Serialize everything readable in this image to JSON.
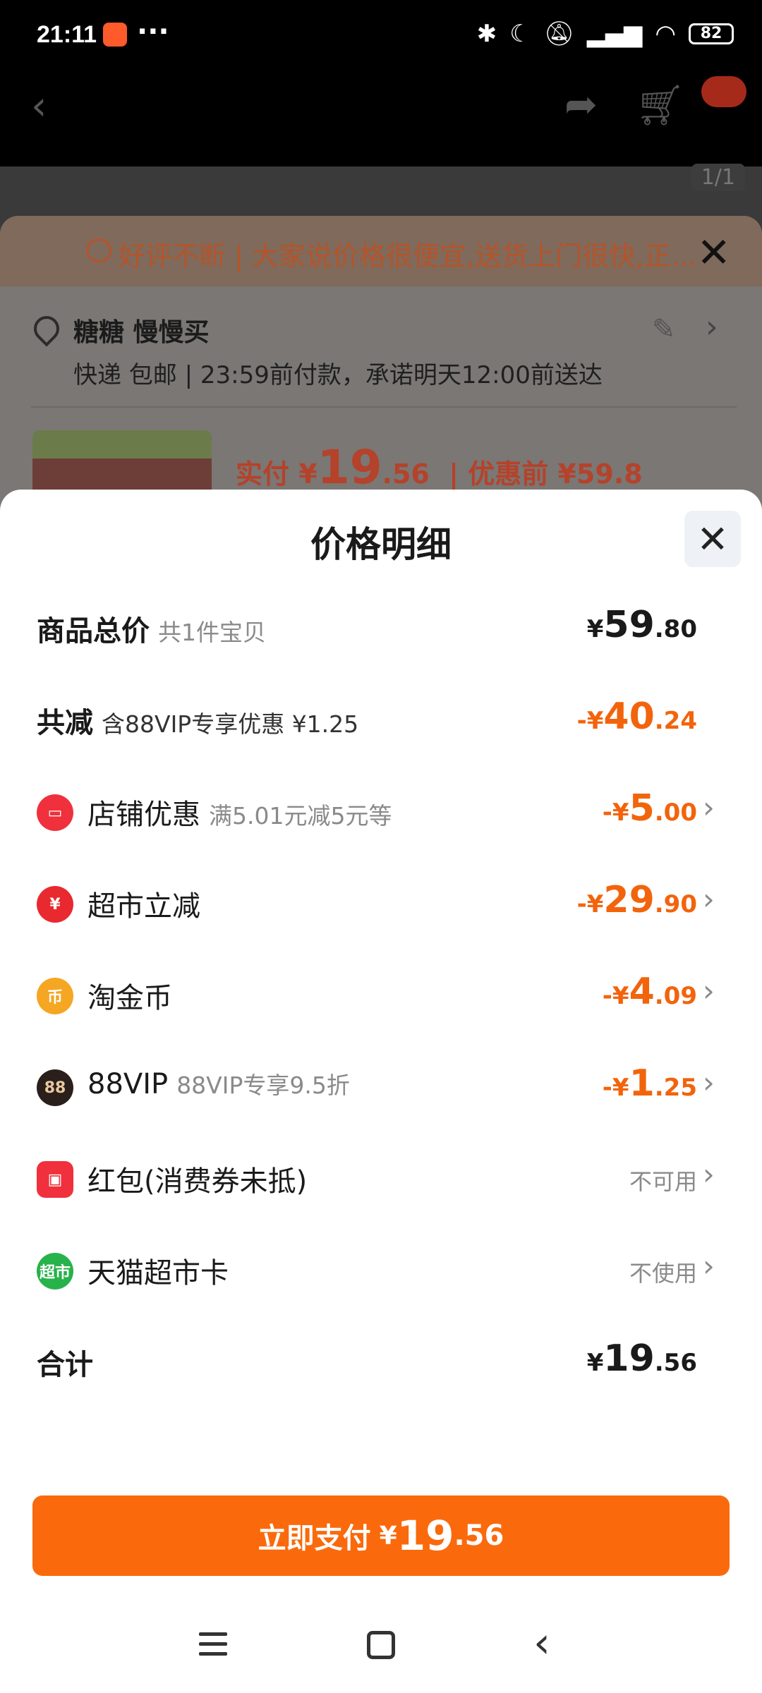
{
  "status_bar": {
    "time": "21:11",
    "dots": "···",
    "battery": "82",
    "icons": [
      "bluetooth-icon",
      "moon-icon",
      "mute-icon",
      "signal-icon",
      "wifi-icon"
    ]
  },
  "background": {
    "pager": "1/1",
    "banner_text": "好评不断 | 大家说价格很便宜,送货上门很快,正...",
    "address_name": "糖糖 慢慢买",
    "address_sub": "快递 包邮 | 23:59前付款，承诺明天12:00前送达",
    "price_prefix": "实付 ¥",
    "price_int": "19",
    "price_dec": ".56",
    "price_before": "| 优惠前 ¥59.8"
  },
  "sheet": {
    "title": "价格明细",
    "rows": [
      {
        "label": "商品总价",
        "sub": "共1件宝贝",
        "cur": "¥",
        "int": "59",
        "dec": ".80"
      },
      {
        "label": "共减",
        "sub": "含88VIP专享优惠 ¥1.25",
        "cur": "-¥",
        "int": "40",
        "dec": ".24"
      },
      {
        "label": "店铺优惠",
        "sub": "满5.01元减5元等",
        "cur": "-¥",
        "int": "5",
        "dec": ".00"
      },
      {
        "label": "超市立减",
        "sub": "",
        "cur": "-¥",
        "int": "29",
        "dec": ".90"
      },
      {
        "label": "淘金币",
        "sub": "",
        "cur": "-¥",
        "int": "4",
        "dec": ".09"
      },
      {
        "label": "88VIP",
        "sub": "88VIP专享9.5折",
        "cur": "-¥",
        "int": "1",
        "dec": ".25"
      },
      {
        "label": "红包(消费券未抵)",
        "status": "不可用"
      },
      {
        "label": "天猫超市卡",
        "status": "不使用"
      },
      {
        "label": "合计",
        "cur": "¥",
        "int": "19",
        "dec": ".56"
      }
    ],
    "icon_text": {
      "vip": "88",
      "card": "超市"
    },
    "pay_button": {
      "label": "立即支付",
      "cur": "¥",
      "int": "19",
      "dec": ".56"
    }
  },
  "colors": {
    "accent": "#fa6a0c",
    "discount": "#f2640c"
  }
}
